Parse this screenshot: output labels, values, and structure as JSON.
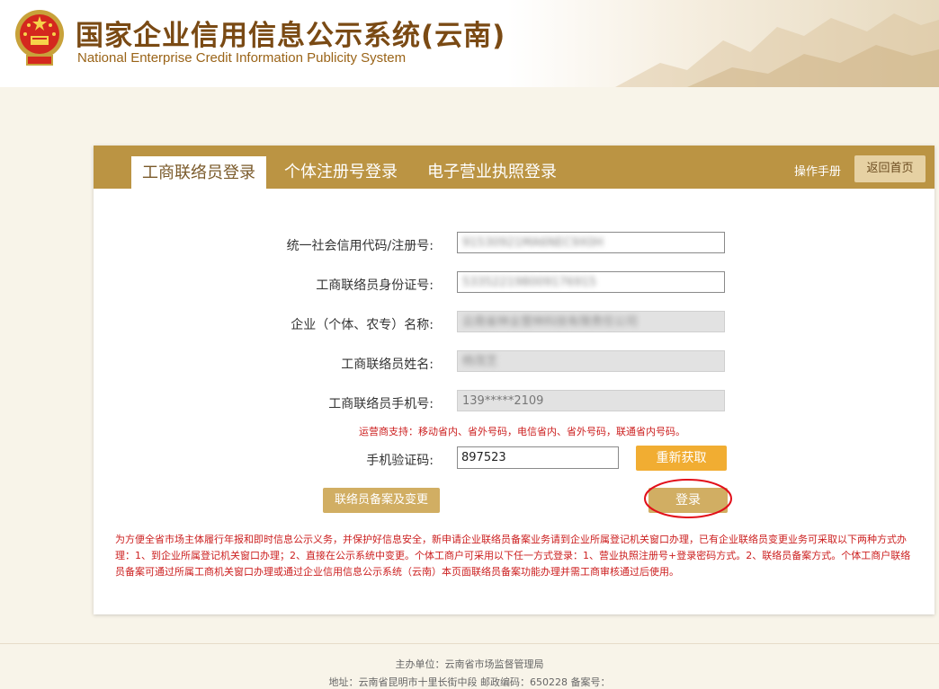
{
  "header": {
    "title_cn": "国家企业信用信息公示系统(云南)",
    "title_en": "National Enterprise Credit Information Publicity System"
  },
  "tabs": [
    {
      "label": "工商联络员登录",
      "active": true
    },
    {
      "label": "个体注册号登录",
      "active": false
    },
    {
      "label": "电子营业执照登录",
      "active": false
    }
  ],
  "toolbar": {
    "manual_label": "操作手册",
    "home_label": "返回首页"
  },
  "form": {
    "credit_code_label": "统一社会信用代码/注册号:",
    "credit_code_value": "91530921MA6NEC9X0H",
    "id_label": "工商联络员身份证号:",
    "id_value": "533522198009176915",
    "name_label": "企业（个体、农专）名称:",
    "name_value": "云南省林业营林科技有限责任公司",
    "contact_name_label": "工商联络员姓名:",
    "contact_name_value": "杨茂芝",
    "phone_label": "工商联络员手机号:",
    "phone_value": "139*****2109",
    "carrier_notice": "运营商支持：移动省内、省外号码，电信省内、省外号码，联通省内号码。",
    "sms_code_label": "手机验证码:",
    "sms_code_value": "897523",
    "resend_label": "重新获取",
    "filing_label": "联络员备案及变更",
    "login_label": "登录"
  },
  "notice": "为方便全省市场主体履行年报和即时信息公示义务，并保护好信息安全，新申请企业联络员备案业务请到企业所属登记机关窗口办理，已有企业联络员变更业务可采取以下两种方式办理：1、到企业所属登记机关窗口办理；2、直接在公示系统中变更。个体工商户可采用以下任一方式登录：1、营业执照注册号+登录密码方式。2、联络员备案方式。个体工商户联络员备案可通过所属工商机关窗口办理或通过企业信用信息公示系统（云南）本页面联络员备案功能办理并需工商审核通过后使用。",
  "footer": {
    "sponsor": "主办单位：云南省市场监督管理局",
    "address": "地址：云南省昆明市十里长街中段 邮政编码：650228 备案号："
  },
  "colors": {
    "tab_bar": "#bb9443",
    "accent_orange": "#f1ad32",
    "button_gold": "#d1ae63",
    "notice_red": "#cc2020"
  }
}
